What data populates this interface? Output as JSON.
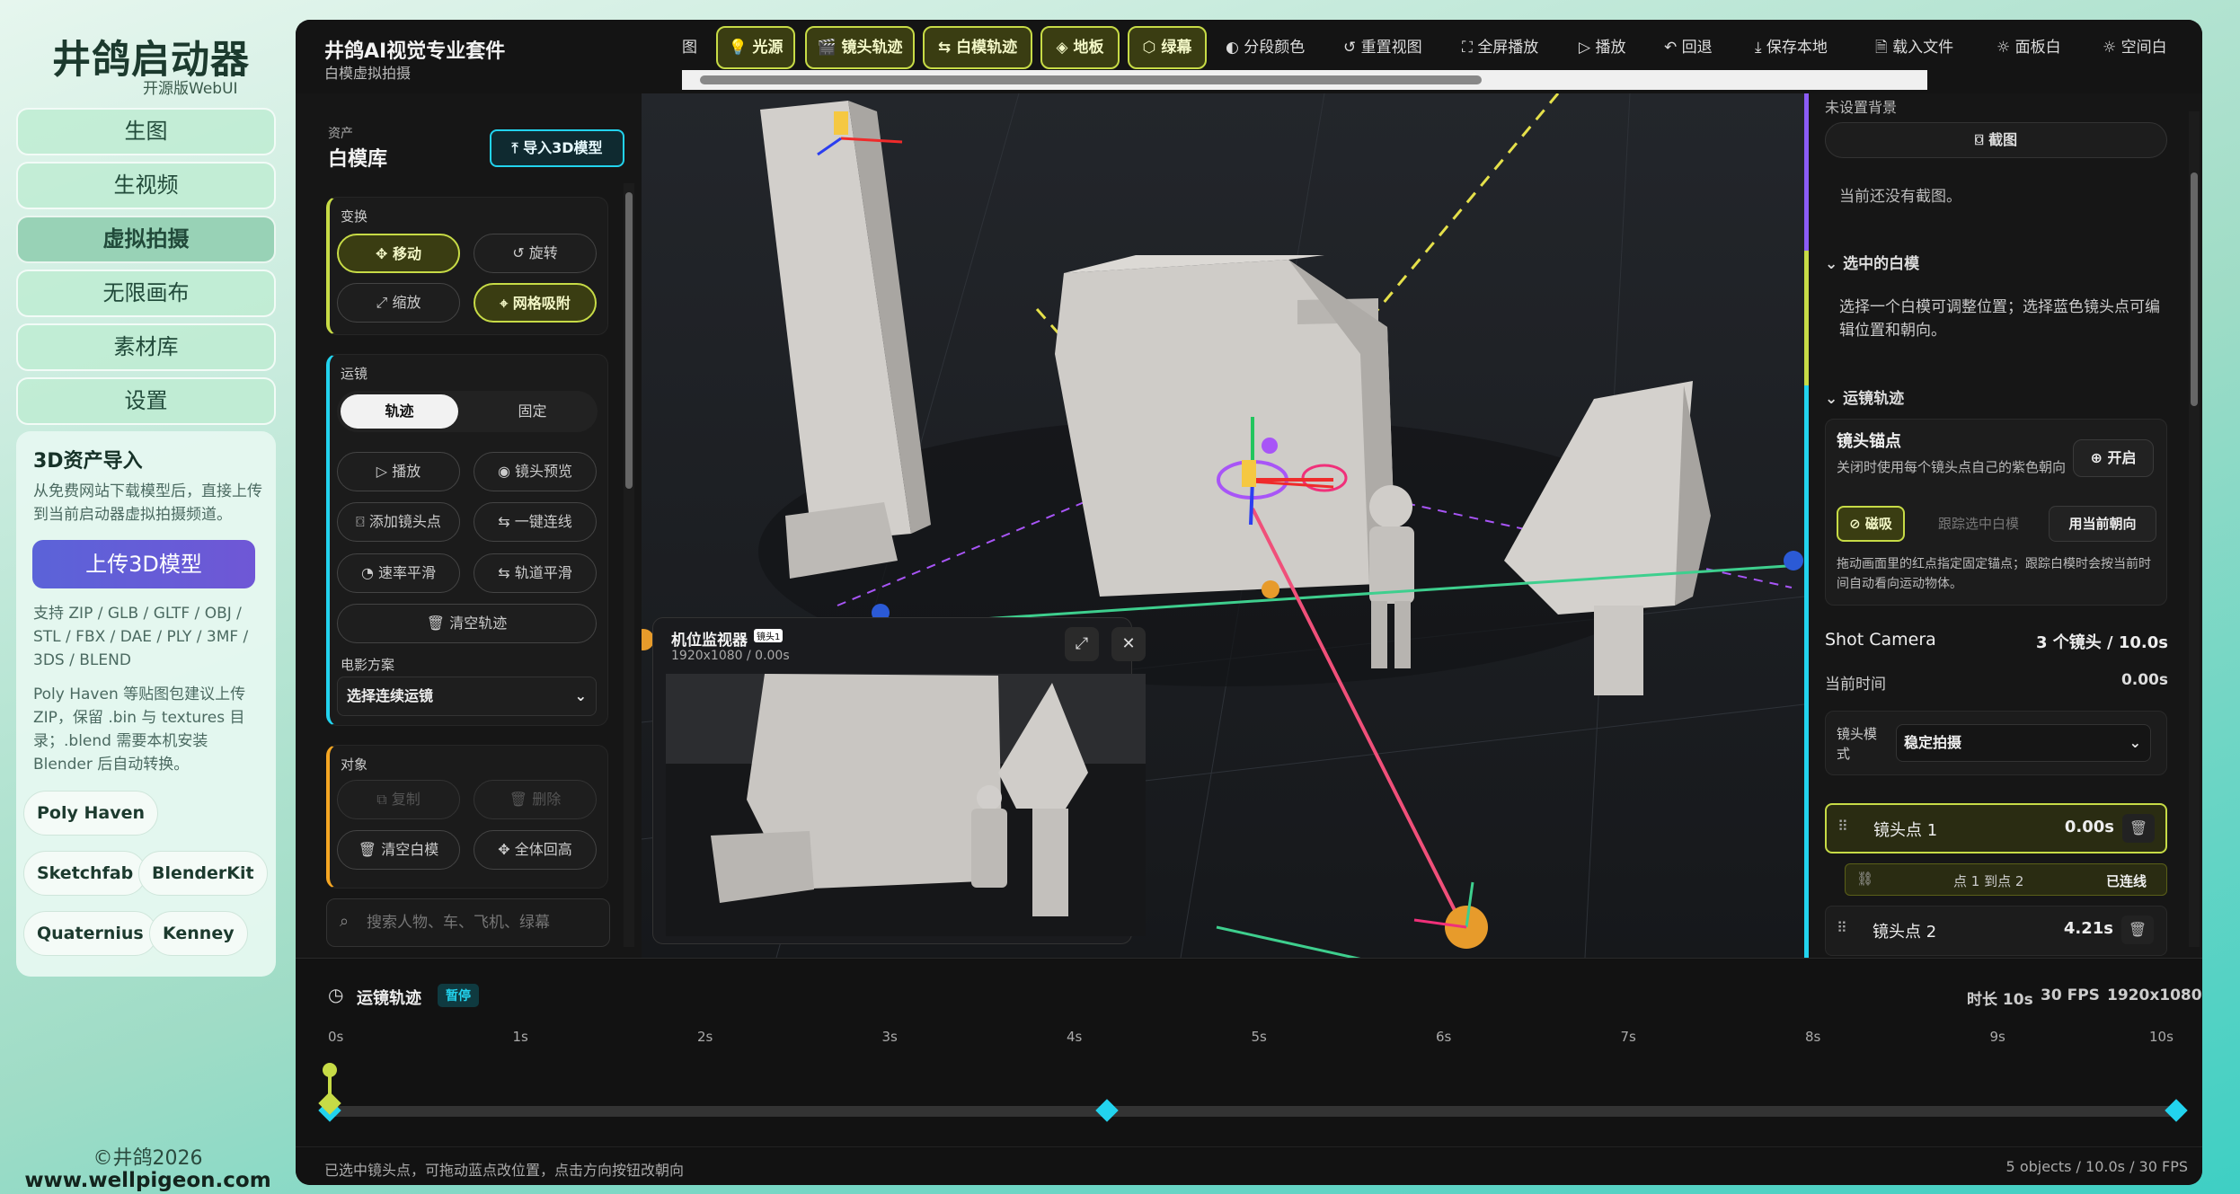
{
  "sidebar": {
    "brand": "井鸽启动器",
    "brand_sub": "开源版WebUI",
    "nav": [
      "生图",
      "生视频",
      "虚拟拍摄",
      "无限画布",
      "素材库",
      "设置"
    ],
    "active": "虚拟拍摄",
    "card": {
      "title": "3D资产导入",
      "desc": "从免费网站下载模型后，直接上传到当前启动器虚拟拍摄频道。",
      "upload": "上传3D模型",
      "formats": "支持 ZIP / GLB / GLTF / OBJ / STL / FBX / DAE / PLY / 3MF / 3DS / BLEND",
      "note": "Poly Haven 等贴图包建议上传 ZIP，保留 .bin 与 textures 目录；.blend 需要本机安装 Blender 后自动转换。",
      "chips": [
        "Poly Haven",
        "Sketchfab",
        "BlenderKit",
        "Quaternius",
        "Kenney"
      ]
    },
    "copyright": "©井鸽2026",
    "url": "www.wellpigeon.com"
  },
  "topbar": {
    "title": "井鸽AI视觉专业套件",
    "subtitle": "白模虚拟拍摄",
    "partial": "图",
    "active_tools": [
      "光源",
      "镜头轨迹",
      "白模轨迹",
      "地板",
      "绿幕"
    ],
    "tools": [
      "分段颜色",
      "重置视图",
      "全屏播放",
      "播放",
      "回退",
      "保存本地",
      "载入文件",
      "面板白",
      "空间白"
    ]
  },
  "left": {
    "asset_label": "资产",
    "asset_title": "白模库",
    "import_btn": "导入3D模型",
    "transform": {
      "label": "变换",
      "move": "移动",
      "rotate": "旋转",
      "scale": "缩放",
      "snap": "网格吸附"
    },
    "motion": {
      "label": "运镜",
      "track": "轨迹",
      "fixed": "固定",
      "play": "播放",
      "preview": "镜头预览",
      "add": "添加镜头点",
      "link": "一键连线",
      "speed": "速率平滑",
      "smooth": "轨道平滑",
      "clear": "清空轨迹",
      "film_label": "电影方案",
      "film_value": "选择连续运镜"
    },
    "object": {
      "label": "对象",
      "copy": "复制",
      "delete": "删除",
      "clear": "清空白模",
      "center": "全体回高"
    },
    "search_placeholder": "搜索人物、车、飞机、绿幕"
  },
  "viewport": {
    "monitor_title": "机位监视器",
    "monitor_info": "1920x1080 / 0.00s",
    "badge": "镜头1"
  },
  "right": {
    "no_bg": "未设置背景",
    "shot_btn": "截图",
    "no_shot": "当前还没有截图。",
    "sel_title": "选中的白模",
    "sel_desc": "选择一个白模可调整位置；选择蓝色镜头点可编辑位置和朝向。",
    "track_title": "运镜轨迹",
    "anchor_title": "镜头锚点",
    "anchor_desc": "关闭时使用每个镜头点自己的紫色朝向",
    "anchor_btn": "开启",
    "magnet": "磁吸",
    "follow": "跟踪选中白模",
    "use_dir": "用当前朝向",
    "anchor_note": "拖动画面里的红点指定固定锚点；跟踪白模时会按当前时间自动看向运动物体。",
    "shot_camera": "Shot Camera",
    "shot_count": "3 个镜头 / 10.0s",
    "cur_time_label": "当前时间",
    "cur_time": "0.00s",
    "mode_label": "镜头模式",
    "mode_value": "稳定拍摄",
    "points": [
      {
        "name": "镜头点 1",
        "time": "0.00s"
      },
      {
        "name": "镜头点 2",
        "time": "4.21s"
      }
    ],
    "link_text": "点 1 到点 2",
    "link_status": "已连线"
  },
  "timeline": {
    "title": "运镜轨迹",
    "status": "暂停",
    "duration": "时长 10s",
    "fps": "30 FPS",
    "res": "1920x1080",
    "ticks": [
      "0s",
      "1s",
      "2s",
      "3s",
      "4s",
      "5s",
      "6s",
      "7s",
      "8s",
      "9s",
      "10s"
    ],
    "keyframes": [
      0,
      4.21,
      10
    ],
    "playhead": 0
  },
  "statusbar": {
    "left": "已选中镜头点，可拖动蓝点改位置，点击方向按钮改朝向",
    "right": "5 objects / 10.0s / 30 FPS"
  },
  "colors": {
    "accent": "#c7db46",
    "green_track": "#3ecf8e",
    "cyan": "#22d3ee",
    "pink": "#f0507a",
    "purple": "#a855f7"
  }
}
